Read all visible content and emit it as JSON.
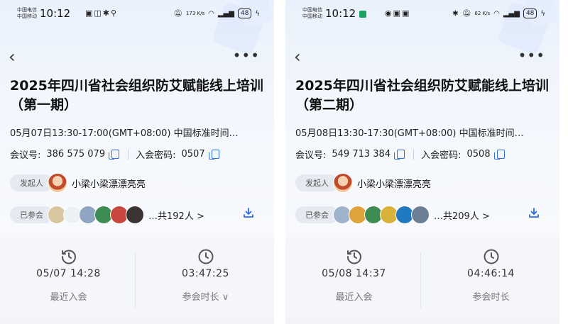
{
  "panels": [
    {
      "status": {
        "carrier1": "中国电信",
        "carrier2": "中国移动",
        "time": "10:12",
        "net_speed": "173 K/s",
        "battery": "48"
      },
      "title": "2025年四川省社会组织防艾赋能线上培训（第一期）",
      "time_text": "05月07日13:30-17:00(GMT+08:00) 中国标准时间…",
      "meeting_id_label": "会议号:",
      "meeting_id": "386 575 079",
      "password_label": "入会密码:",
      "password": "0507",
      "host_label": "发起人",
      "host_name": "小梁小梁漂漂亮亮",
      "participants_label": "已参会",
      "participants_count": "…共192人 >",
      "last_join": "05/07 14:28",
      "last_join_label": "最近入会",
      "duration": "03:47:25",
      "duration_label": "参会时长 ∨"
    },
    {
      "status": {
        "carrier1": "中国电信",
        "carrier2": "中国移动",
        "time": "10:12",
        "net_speed": "62 K/s",
        "battery": "48"
      },
      "title": "2025年四川省社会组织防艾赋能线上培训（第二期）",
      "time_text": "05月08日13:30-17:30(GMT+08:00) 中国标准时间…",
      "meeting_id_label": "会议号:",
      "meeting_id": "549 713 384",
      "password_label": "入会密码:",
      "password": "0508",
      "host_label": "发起人",
      "host_name": "小梁小梁漂漂亮亮",
      "participants_label": "已参会",
      "participants_count": "…共209人 >",
      "last_join": "05/08 14:37",
      "last_join_label": "最近入会",
      "duration": "04:46:14",
      "duration_label": "参会时长"
    }
  ],
  "icons": {
    "back": "chevron-left-icon",
    "more": "more-dots-icon",
    "copy": "copy-icon",
    "download": "download-icon",
    "history": "history-clock-icon",
    "clock": "clock-icon"
  },
  "colors": {
    "accent": "#2f6ce5",
    "pill_bg": "#e6e9ef"
  }
}
